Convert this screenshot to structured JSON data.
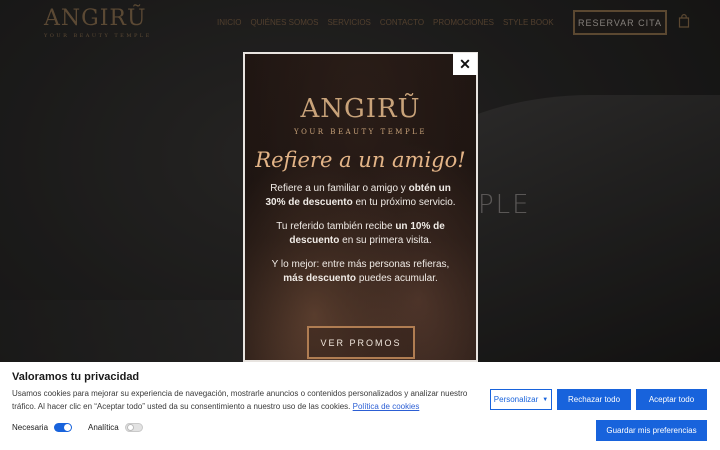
{
  "header": {
    "logo_main": "ANGIRŨ",
    "logo_sub": "YOUR BEAUTY TEMPLE",
    "nav": [
      "INICIO",
      "QUIÉNES SOMOS",
      "SERVICIOS",
      "CONTACTO",
      "PROMOCIONES",
      "STYLE BOOK"
    ],
    "reserve_label": "RESERVAR CITA",
    "cart_icon": "shopping-bag-icon"
  },
  "hero": {
    "partial_word": "PLE"
  },
  "modal": {
    "logo_main": "ANGIRŨ",
    "logo_sub": "YOUR BEAUTY TEMPLE",
    "headline": "Refiere a un amigo!",
    "p1_a": "Refiere a un familiar o amigo y ",
    "p1_b": "obtén un 30% de descuento",
    "p1_c": " en tu próximo servicio.",
    "p2_a": "Tu referido también recibe ",
    "p2_b": "un 10% de descuento",
    "p2_c": " en su primera visita.",
    "p3_a": "Y lo mejor: entre más personas refieras, ",
    "p3_b": "más descuento",
    "p3_c": " puedes acumular.",
    "button_label": "VER PROMOS",
    "close_glyph": "✕"
  },
  "cookie": {
    "title": "Valoramos tu privacidad",
    "text": "Usamos cookies para mejorar su experiencia de navegación, mostrarle anuncios o contenidos personalizados y analizar nuestro tráfico. Al hacer clic en “Aceptar todo” usted da su consentimiento a nuestro uso de las cookies. ",
    "link": "Política de cookies",
    "toggle_necessary": "Necesaria",
    "toggle_analytics": "Analítica",
    "btn_customize": "Personalizar",
    "btn_reject": "Rechazar todo",
    "btn_accept": "Aceptar todo",
    "btn_save": "Guardar mis preferencias",
    "accent": "#1863dc"
  }
}
